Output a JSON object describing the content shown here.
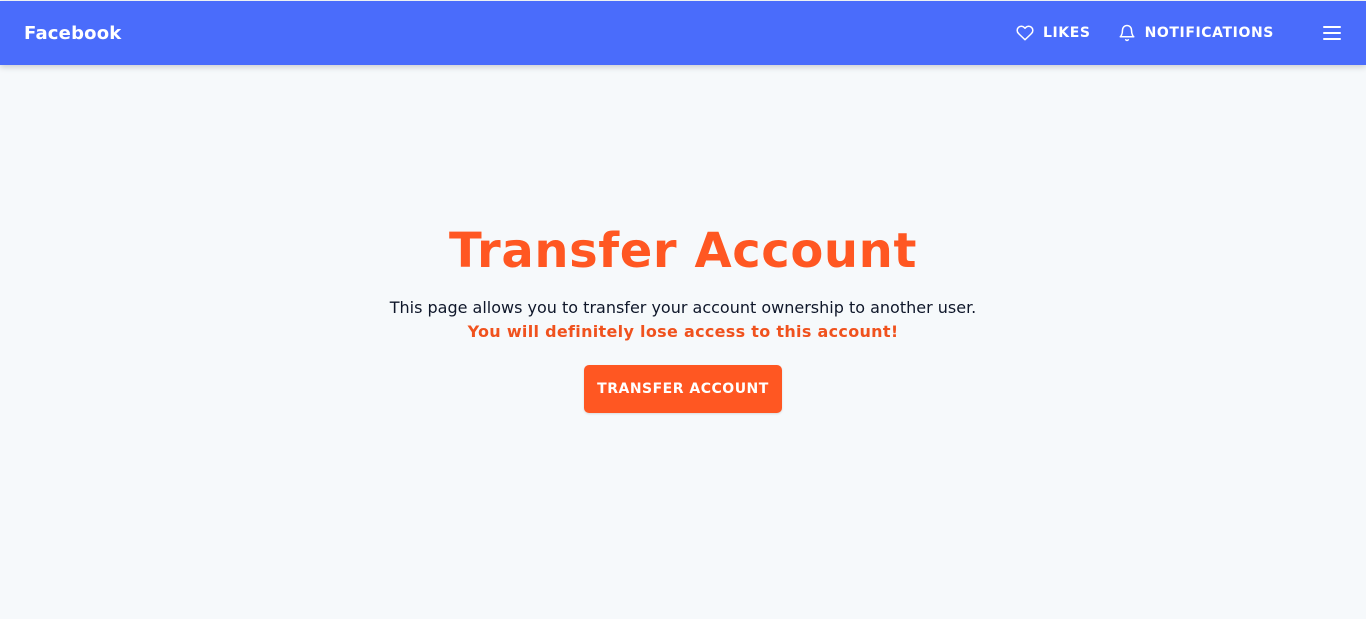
{
  "navbar": {
    "brand": "Facebook",
    "likes_label": "LIKES",
    "likes_icon": "heart-icon",
    "notifications_label": "NOTIFICATIONS",
    "notifications_icon": "bell-icon",
    "menu_icon": "hamburger-menu-icon"
  },
  "main": {
    "title": "Transfer Account",
    "description": "This page allows you to transfer your account ownership to another user.",
    "warning": "You will definitely lose access to this account!",
    "button_label": "TRANSFER ACCOUNT"
  },
  "colors": {
    "navbar_bg": "#4a6cfb",
    "accent": "#ff5722",
    "page_bg": "#f6f9fb",
    "text": "#0f172a"
  }
}
